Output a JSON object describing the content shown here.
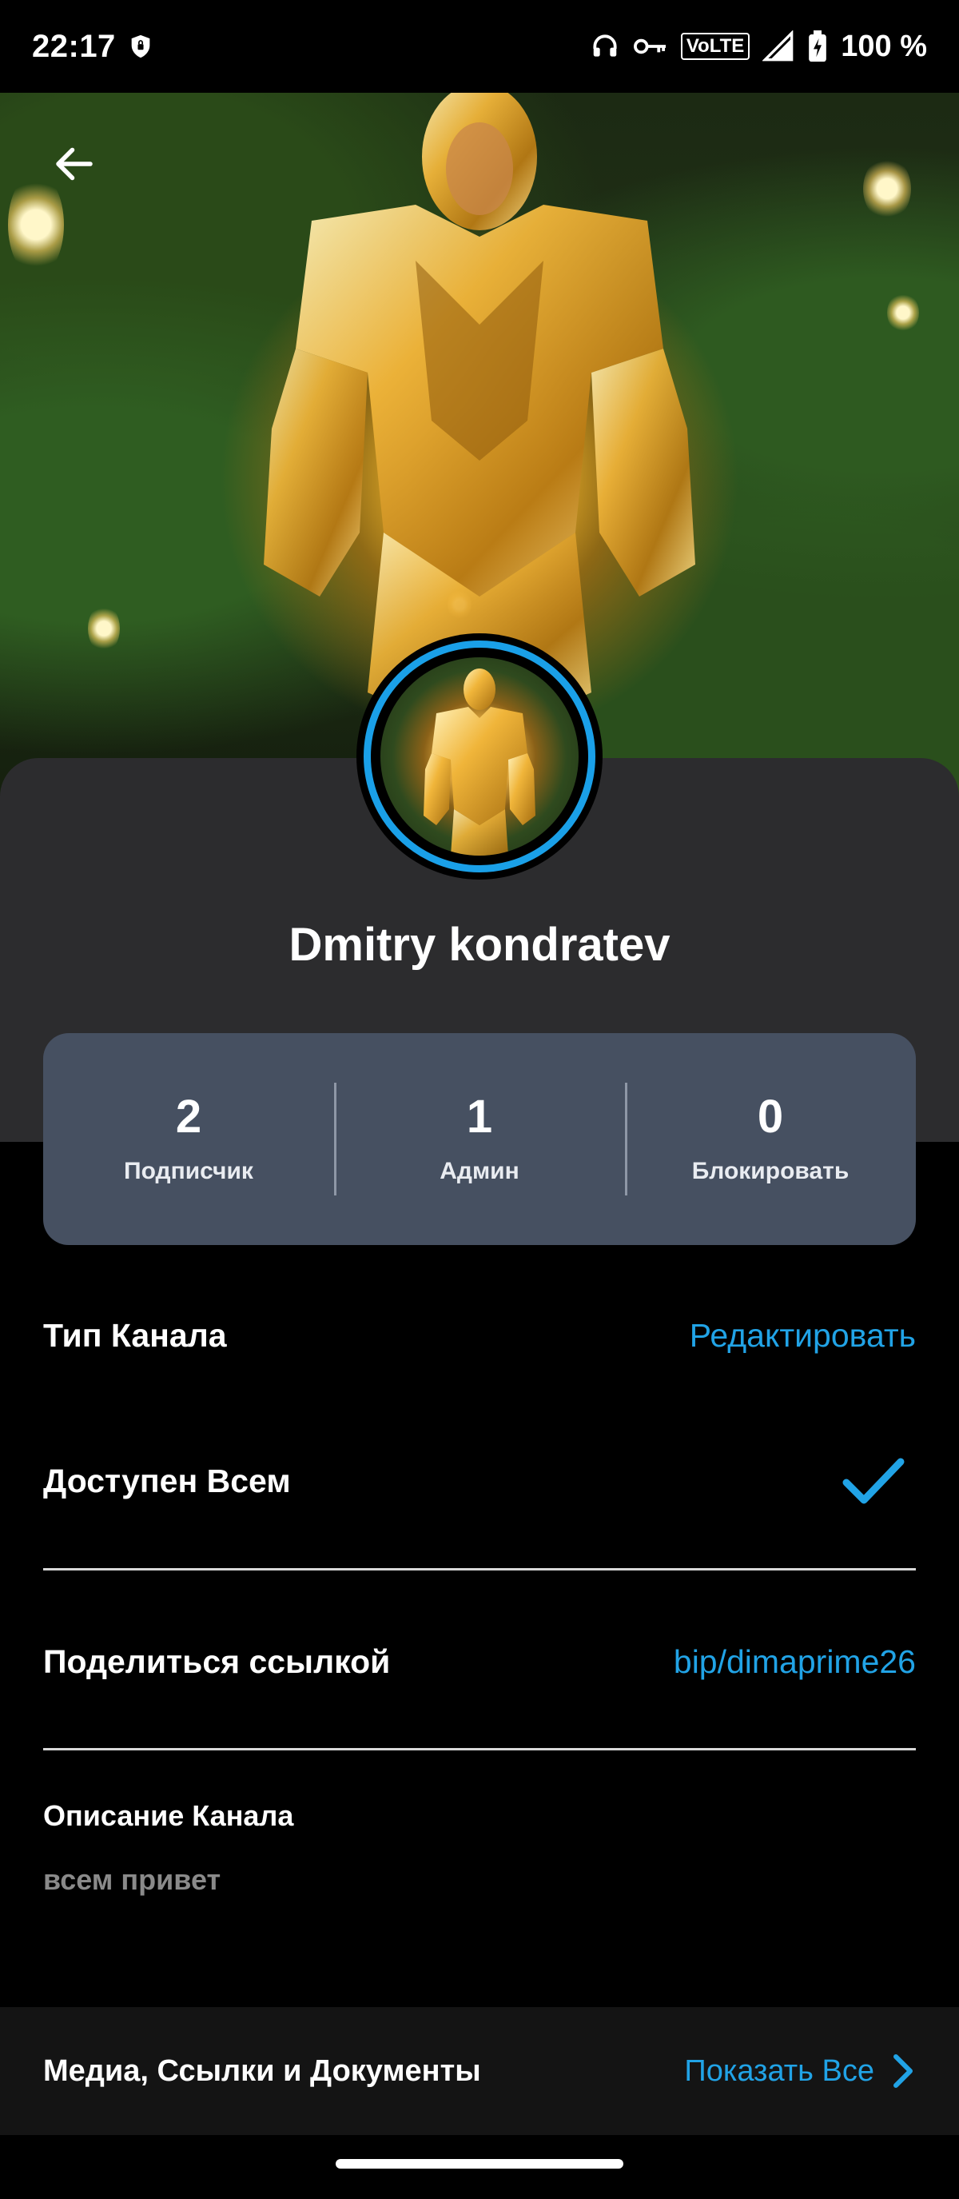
{
  "status_bar": {
    "time": "22:17",
    "network": "VoLTE",
    "battery": "100 %",
    "icons": [
      "shield-icon",
      "headphones-icon",
      "key-icon",
      "volte-icon",
      "signal-icon",
      "battery-icon"
    ]
  },
  "header": {
    "back_icon": "arrow-left-icon"
  },
  "profile": {
    "name": "Dmitry kondratev"
  },
  "stats": [
    {
      "value": "2",
      "label": "Подписчик"
    },
    {
      "value": "1",
      "label": "Админ"
    },
    {
      "value": "0",
      "label": "Блокировать"
    }
  ],
  "channel_type": {
    "title": "Тип Канала",
    "edit_label": "Редактировать",
    "option_label": "Доступен Всем",
    "option_selected": true
  },
  "share": {
    "title": "Поделиться ссылкой",
    "link": "bip/dimaprime26"
  },
  "description": {
    "title": "Описание Канала",
    "text": "всем привет"
  },
  "media": {
    "title": "Медиа, Ссылки и Документы",
    "show_all": "Показать Все"
  },
  "colors": {
    "accent": "#21a3e6",
    "card": "#2c2c2e",
    "stats_bg": "#465061",
    "background": "#000000"
  }
}
